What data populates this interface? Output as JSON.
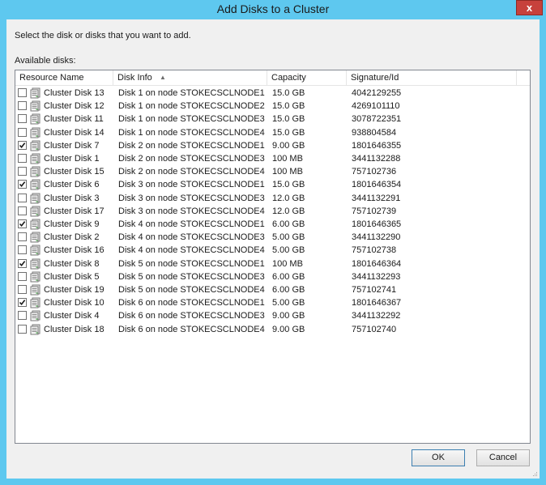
{
  "window": {
    "title": "Add Disks to a Cluster",
    "close_label": "x"
  },
  "instruction": "Select the disk or disks that you want to add.",
  "available_label": "Available disks:",
  "columns": [
    "Resource Name",
    "Disk Info",
    "Capacity",
    "Signature/Id"
  ],
  "sort_indicator": "▲",
  "rows": [
    {
      "name": "Cluster Disk 13",
      "info": "Disk 1 on node STOKECSCLNODE1",
      "capacity": "15.0 GB",
      "signature": "4042129255",
      "checked": false
    },
    {
      "name": "Cluster Disk 12",
      "info": "Disk 1 on node STOKECSCLNODE2",
      "capacity": "15.0 GB",
      "signature": "4269101110",
      "checked": false
    },
    {
      "name": "Cluster Disk 11",
      "info": "Disk 1 on node STOKECSCLNODE3",
      "capacity": "15.0 GB",
      "signature": "3078722351",
      "checked": false
    },
    {
      "name": "Cluster Disk 14",
      "info": "Disk 1 on node STOKECSCLNODE4",
      "capacity": "15.0 GB",
      "signature": "938804584",
      "checked": false
    },
    {
      "name": "Cluster Disk 7",
      "info": "Disk 2 on node STOKECSCLNODE1",
      "capacity": "9.00 GB",
      "signature": "1801646355",
      "checked": true
    },
    {
      "name": "Cluster Disk 1",
      "info": "Disk 2 on node STOKECSCLNODE3",
      "capacity": "100 MB",
      "signature": "3441132288",
      "checked": false
    },
    {
      "name": "Cluster Disk 15",
      "info": "Disk 2 on node STOKECSCLNODE4",
      "capacity": "100 MB",
      "signature": "757102736",
      "checked": false
    },
    {
      "name": "Cluster Disk 6",
      "info": "Disk 3 on node STOKECSCLNODE1",
      "capacity": "15.0 GB",
      "signature": "1801646354",
      "checked": true
    },
    {
      "name": "Cluster Disk 3",
      "info": "Disk 3 on node STOKECSCLNODE3",
      "capacity": "12.0 GB",
      "signature": "3441132291",
      "checked": false
    },
    {
      "name": "Cluster Disk 17",
      "info": "Disk 3 on node STOKECSCLNODE4",
      "capacity": "12.0 GB",
      "signature": "757102739",
      "checked": false
    },
    {
      "name": "Cluster Disk 9",
      "info": "Disk 4 on node STOKECSCLNODE1",
      "capacity": "6.00 GB",
      "signature": "1801646365",
      "checked": true
    },
    {
      "name": "Cluster Disk 2",
      "info": "Disk 4 on node STOKECSCLNODE3",
      "capacity": "5.00 GB",
      "signature": "3441132290",
      "checked": false
    },
    {
      "name": "Cluster Disk 16",
      "info": "Disk 4 on node STOKECSCLNODE4",
      "capacity": "5.00 GB",
      "signature": "757102738",
      "checked": false
    },
    {
      "name": "Cluster Disk 8",
      "info": "Disk 5 on node STOKECSCLNODE1",
      "capacity": "100 MB",
      "signature": "1801646364",
      "checked": true
    },
    {
      "name": "Cluster Disk 5",
      "info": "Disk 5 on node STOKECSCLNODE3",
      "capacity": "6.00 GB",
      "signature": "3441132293",
      "checked": false
    },
    {
      "name": "Cluster Disk 19",
      "info": "Disk 5 on node STOKECSCLNODE4",
      "capacity": "6.00 GB",
      "signature": "757102741",
      "checked": false
    },
    {
      "name": "Cluster Disk 10",
      "info": "Disk 6 on node STOKECSCLNODE1",
      "capacity": "5.00 GB",
      "signature": "1801646367",
      "checked": true
    },
    {
      "name": "Cluster Disk 4",
      "info": "Disk 6 on node STOKECSCLNODE3",
      "capacity": "9.00 GB",
      "signature": "3441132292",
      "checked": false
    },
    {
      "name": "Cluster Disk 18",
      "info": "Disk 6 on node STOKECSCLNODE4",
      "capacity": "9.00 GB",
      "signature": "757102740",
      "checked": false
    }
  ],
  "buttons": {
    "ok": "OK",
    "cancel": "Cancel"
  },
  "colors": {
    "titlebar": "#5ec8ef",
    "close": "#c7413c",
    "dialog_bg": "#f0f0f0",
    "check": "#1a1a1a"
  },
  "icons": {
    "row": "disk-icon",
    "close": "close-icon",
    "sort": "sort-ascending-icon",
    "grip": "resize-grip-icon"
  }
}
